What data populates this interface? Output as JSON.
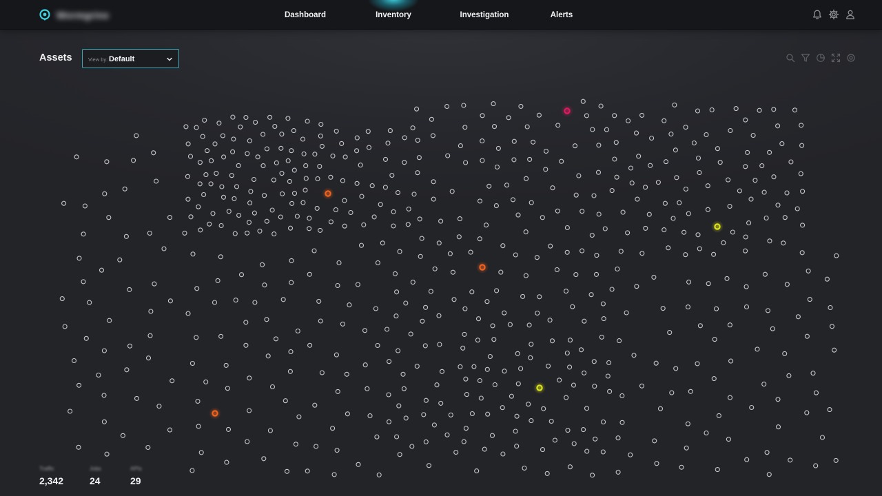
{
  "app": {
    "brand_name": "Wormgrine",
    "colors": {
      "accent": "#3fd0e0",
      "node": "#c7c9cc",
      "alert_red": "#e0195f",
      "alert_orange": "#f0621e",
      "alert_yellow": "#d9e21a"
    }
  },
  "nav": {
    "tabs": [
      {
        "label": "Dashboard",
        "active": false
      },
      {
        "label": "Inventory",
        "active": true
      },
      {
        "label": "Investigation",
        "active": false
      },
      {
        "label": "Alerts",
        "active": false
      }
    ],
    "icons": [
      "bell-icon",
      "gear-icon",
      "user-icon"
    ]
  },
  "page": {
    "title": "Assets",
    "view_select": {
      "prefix": "View by:",
      "value": "Default"
    },
    "tools": [
      "search-icon",
      "filter-icon",
      "pie-chart-icon",
      "expand-icon",
      "target-icon"
    ]
  },
  "stats": [
    {
      "label": "Traffic",
      "value": "2,342"
    },
    {
      "label": "Jobs",
      "value": "24"
    },
    {
      "label": "APIs",
      "value": "29"
    }
  ],
  "graph": {
    "highlighted_nodes": {
      "red": 1,
      "orange": 3,
      "yellow": 2
    }
  }
}
